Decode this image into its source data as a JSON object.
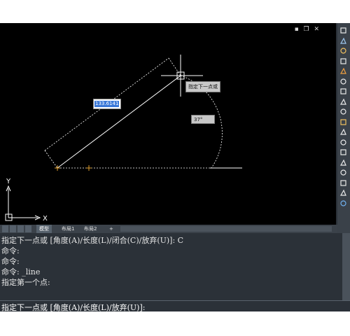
{
  "window_controls": {
    "glyphs": "▪ ❐ ✕"
  },
  "drawing": {
    "length_input": "133.6141",
    "angle_input": "37°",
    "tooltip": "指定下一点或",
    "ucs_x": "X",
    "ucs_y": "Y"
  },
  "tabs": [
    {
      "label": "模型"
    },
    {
      "label": "布局1"
    },
    {
      "label": "布局2"
    },
    {
      "label": "+"
    }
  ],
  "command": {
    "history": [
      "指定下一点或 [角度(A)/长度(L)/闭合(C)/放弃(U)]: C",
      "命令:",
      "命令:",
      "命令: _line",
      "指定第一个点:"
    ],
    "input": "指定下一点或 [角度(A)/长度(L)/放弃(U)]: "
  },
  "toolbar_icons": [
    "eraser-icon",
    "copy-icon",
    "mirror-icon",
    "offset-icon",
    "array-icon",
    "move-icon",
    "rotate-icon",
    "scale-icon",
    "stretch-icon",
    "trim-icon",
    "extend-icon",
    "break-icon",
    "join-icon",
    "chamfer-icon",
    "fillet-icon",
    "blend-icon",
    "explode-icon",
    "properties-icon"
  ]
}
